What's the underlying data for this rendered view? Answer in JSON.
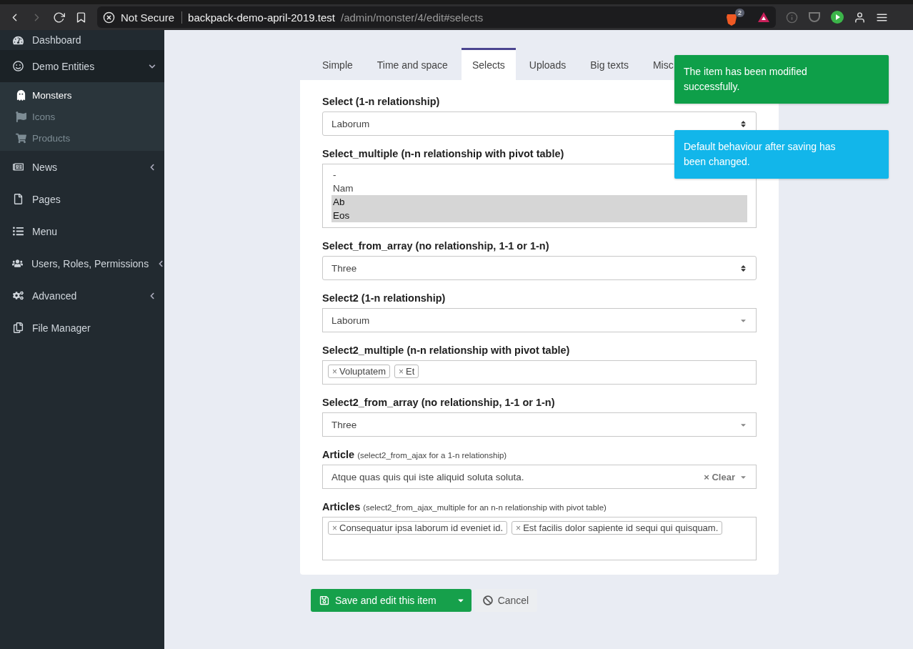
{
  "browser": {
    "security": "Not Secure",
    "url_host": "backpack-demo-april-2019.test",
    "url_path": "/admin/monster/4/edit#selects",
    "shield_count": "2"
  },
  "sidebar": {
    "items": [
      {
        "label": "Dashboard"
      },
      {
        "label": "Demo Entities",
        "expanded": true,
        "children": [
          {
            "label": "Monsters",
            "selected": true
          },
          {
            "label": "Icons",
            "selected": false
          },
          {
            "label": "Products",
            "selected": false
          }
        ]
      },
      {
        "label": "News",
        "expanded": false
      },
      {
        "label": "Pages"
      },
      {
        "label": "Menu"
      },
      {
        "label": "Users, Roles, Permissions",
        "expanded": false
      },
      {
        "label": "Advanced",
        "expanded": false
      },
      {
        "label": "File Manager"
      }
    ]
  },
  "tabs": [
    {
      "label": "Simple",
      "selected": false
    },
    {
      "label": "Time and space",
      "selected": false
    },
    {
      "label": "Selects",
      "selected": true
    },
    {
      "label": "Uploads",
      "selected": false
    },
    {
      "label": "Big texts",
      "selected": false
    },
    {
      "label": "Misc",
      "selected": false
    }
  ],
  "fields": [
    {
      "kind": "select",
      "label": "Select (1-n relationship)",
      "value": "Laborum"
    },
    {
      "kind": "listbox",
      "label": "Select_multiple (n-n relationship with pivot table)",
      "options": [
        {
          "label": "-",
          "selected": false
        },
        {
          "label": "Nam",
          "selected": false
        },
        {
          "label": "Ab",
          "selected": true
        },
        {
          "label": "Eos",
          "selected": true
        }
      ]
    },
    {
      "kind": "select",
      "label": "Select_from_array (no relationship, 1-1 or 1-n)",
      "value": "Three"
    },
    {
      "kind": "select2",
      "label": "Select2 (1-n relationship)",
      "value": "Laborum"
    },
    {
      "kind": "tags",
      "label": "Select2_multiple (n-n relationship with pivot table)",
      "tags": [
        {
          "remove": "×",
          "label": "Voluptatem"
        },
        {
          "remove": "×",
          "label": "Et"
        }
      ]
    },
    {
      "kind": "select2",
      "label": "Select2_from_array (no relationship, 1-1 or 1-n)",
      "value": "Three"
    },
    {
      "kind": "select2",
      "label": "Article",
      "hint": "(select2_from_ajax for a 1-n relationship)",
      "value": "Atque quas quis qui iste aliquid soluta soluta.",
      "clear": "× Clear"
    },
    {
      "kind": "tags-tall",
      "label": "Articles",
      "hint": "(select2_from_ajax_multiple for an n-n relationship with pivot table)",
      "tags": [
        {
          "remove": "×",
          "label": "Consequatur ipsa laborum id eveniet id."
        },
        {
          "remove": "×",
          "label": "Est facilis dolor sapiente id sequi qui quisquam."
        }
      ]
    }
  ],
  "actions": {
    "save": "Save and edit this item",
    "cancel": "Cancel"
  },
  "notifications": [
    {
      "text": "The item has been modified successfully.",
      "color": "#0e9f49"
    },
    {
      "text": "Default behaviour after saving has been changed.",
      "color": "#12b6ea"
    }
  ]
}
